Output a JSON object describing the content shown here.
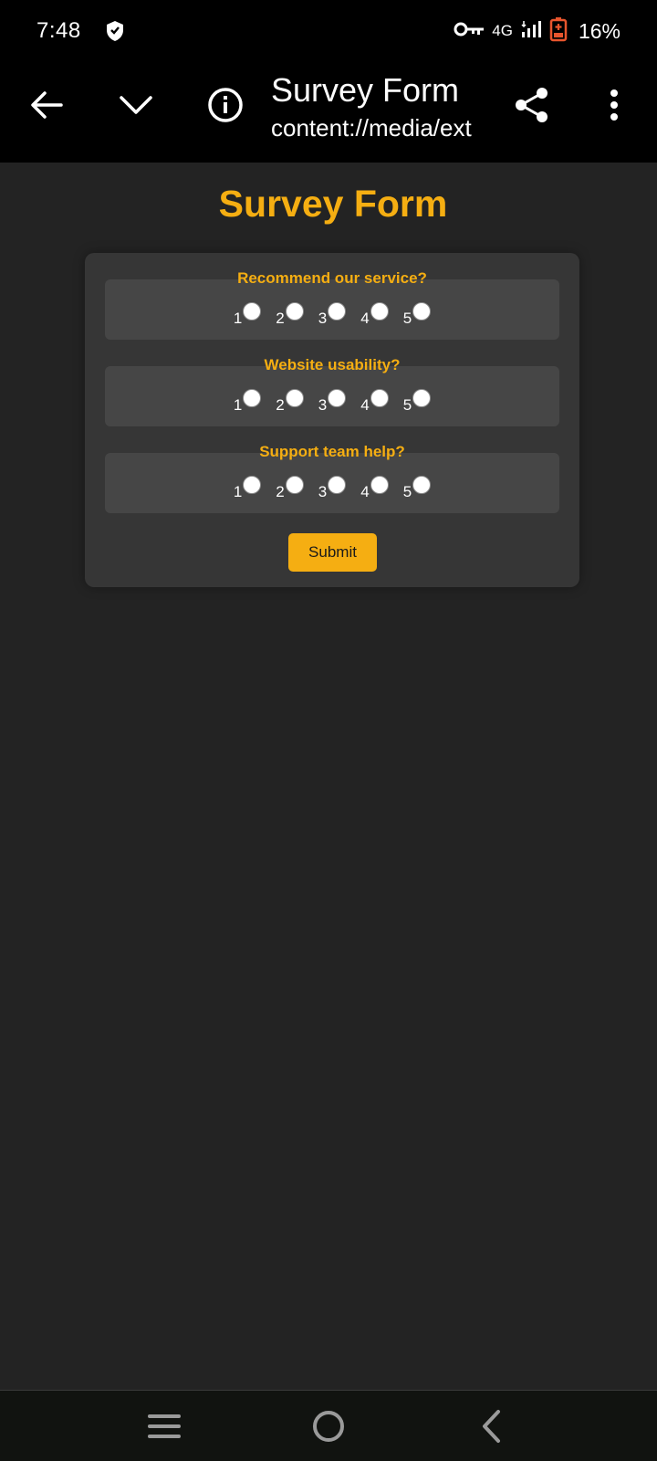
{
  "status_bar": {
    "time": "7:48",
    "network": "4G",
    "battery": "16%",
    "icons": [
      "shield-icon",
      "vpn-key-icon",
      "signal-icon",
      "battery-icon"
    ]
  },
  "app_bar": {
    "title": "Survey Form",
    "subtitle": "content://media/ext",
    "icons": [
      "back-arrow-icon",
      "chevron-down-icon",
      "info-icon",
      "share-icon",
      "more-vert-icon"
    ]
  },
  "page": {
    "heading": "Survey Form",
    "questions": [
      {
        "label": "Recommend our service?",
        "options": [
          "1",
          "2",
          "3",
          "4",
          "5"
        ]
      },
      {
        "label": "Website usability?",
        "options": [
          "1",
          "2",
          "3",
          "4",
          "5"
        ]
      },
      {
        "label": "Support team help?",
        "options": [
          "1",
          "2",
          "3",
          "4",
          "5"
        ]
      }
    ],
    "submit_label": "Submit"
  },
  "colors": {
    "accent": "#f5ae12",
    "background": "#232323",
    "card": "#363636",
    "question_bg": "#464646"
  },
  "nav_bar": {
    "icons": [
      "menu-icon",
      "home-circle-icon",
      "back-chevron-icon"
    ]
  }
}
